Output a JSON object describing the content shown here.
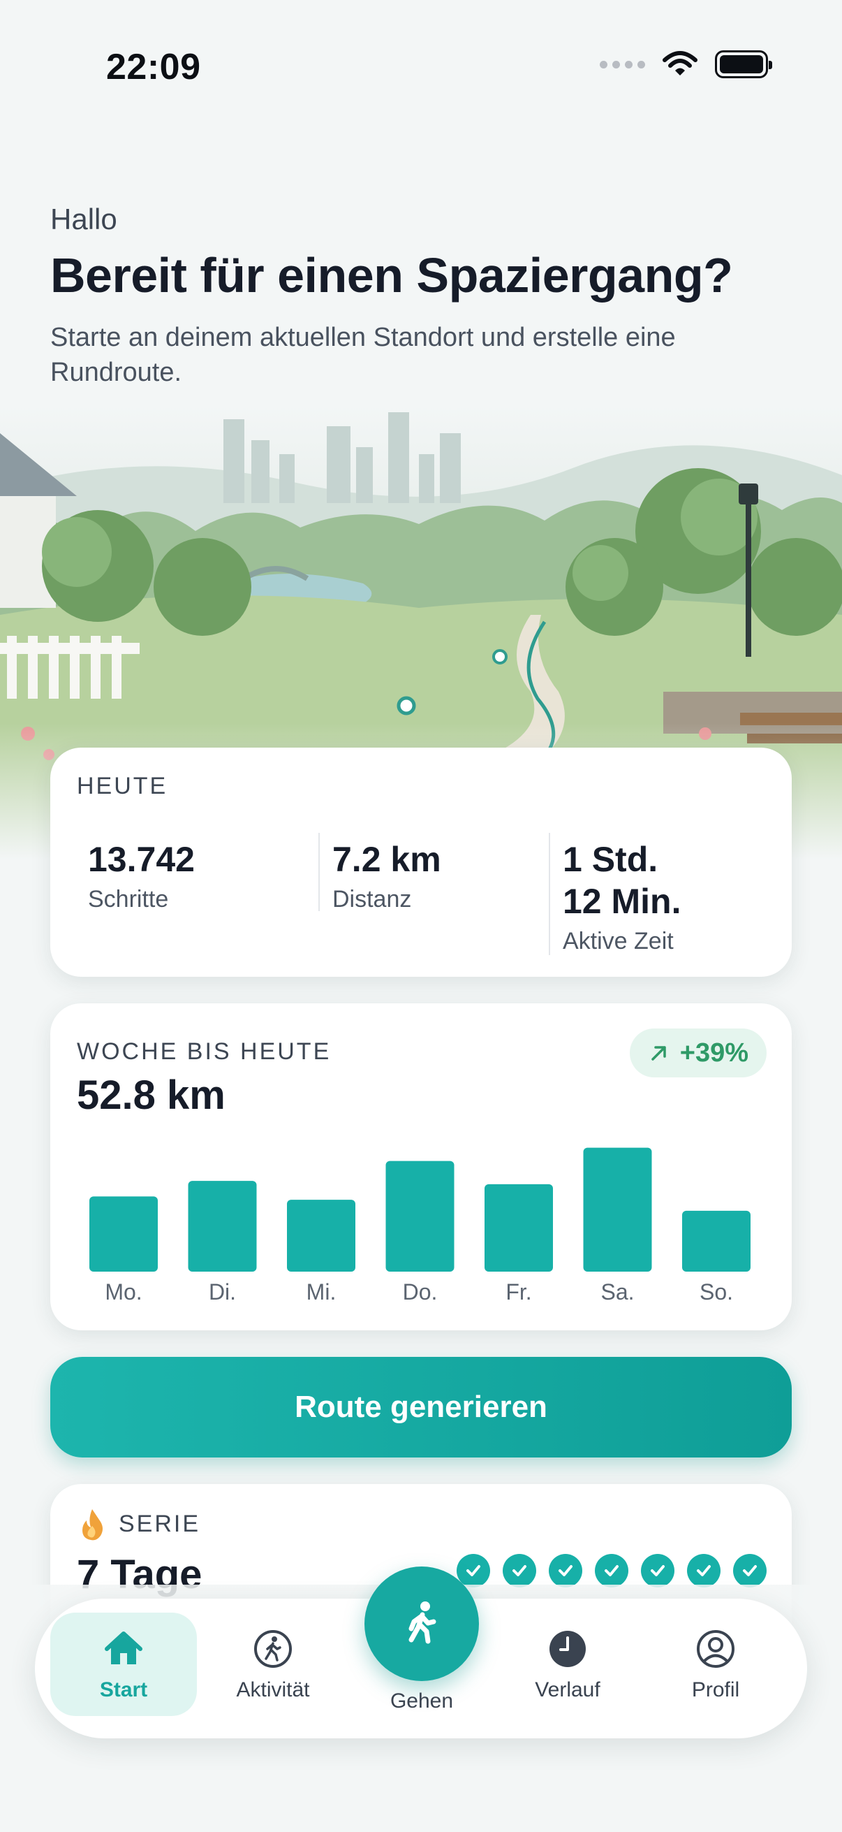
{
  "status_bar": {
    "time": "22:09"
  },
  "header": {
    "greeting": "Hallo",
    "headline": "Bereit für einen Spaziergang?",
    "subtitle": "Starte an deinem aktuellen Standort und erstelle eine Rundroute."
  },
  "today": {
    "label": "HEUTE",
    "steps_value": "13.742",
    "steps_label": "Schritte",
    "distance_value": "7.2 km",
    "distance_label": "Distanz",
    "active_value": "1 Std. 12 Min.",
    "active_label": "Aktive Zeit"
  },
  "week": {
    "label": "WOCHE BIS HEUTE",
    "total": "52.8 km",
    "change": "+39%",
    "accent": "#17b0a8",
    "change_color": "#2f9a67"
  },
  "chart_data": {
    "type": "bar",
    "categories": [
      "Mo.",
      "Di.",
      "Mi.",
      "Do.",
      "Fr.",
      "Sa.",
      "So."
    ],
    "values": [
      6.8,
      8.2,
      6.5,
      10.0,
      7.9,
      11.2,
      5.5
    ],
    "title": "",
    "xlabel": "",
    "ylabel": "",
    "ylim": [
      0,
      12
    ],
    "grid": false
  },
  "cta": {
    "label": "Route generieren"
  },
  "streak": {
    "label": "SERIE",
    "value": "7 Tage",
    "checked_days": 7
  },
  "nav": {
    "start": "Start",
    "activity": "Aktivität",
    "go": "Gehen",
    "history": "Verlauf",
    "profile": "Profil"
  },
  "icons": {
    "home": "home-icon",
    "activity": "walking-person-circle-icon",
    "go": "walking-person-icon",
    "history": "clock-icon",
    "profile": "person-circle-icon",
    "streak": "flame-icon",
    "trend": "arrow-up-right-icon"
  }
}
